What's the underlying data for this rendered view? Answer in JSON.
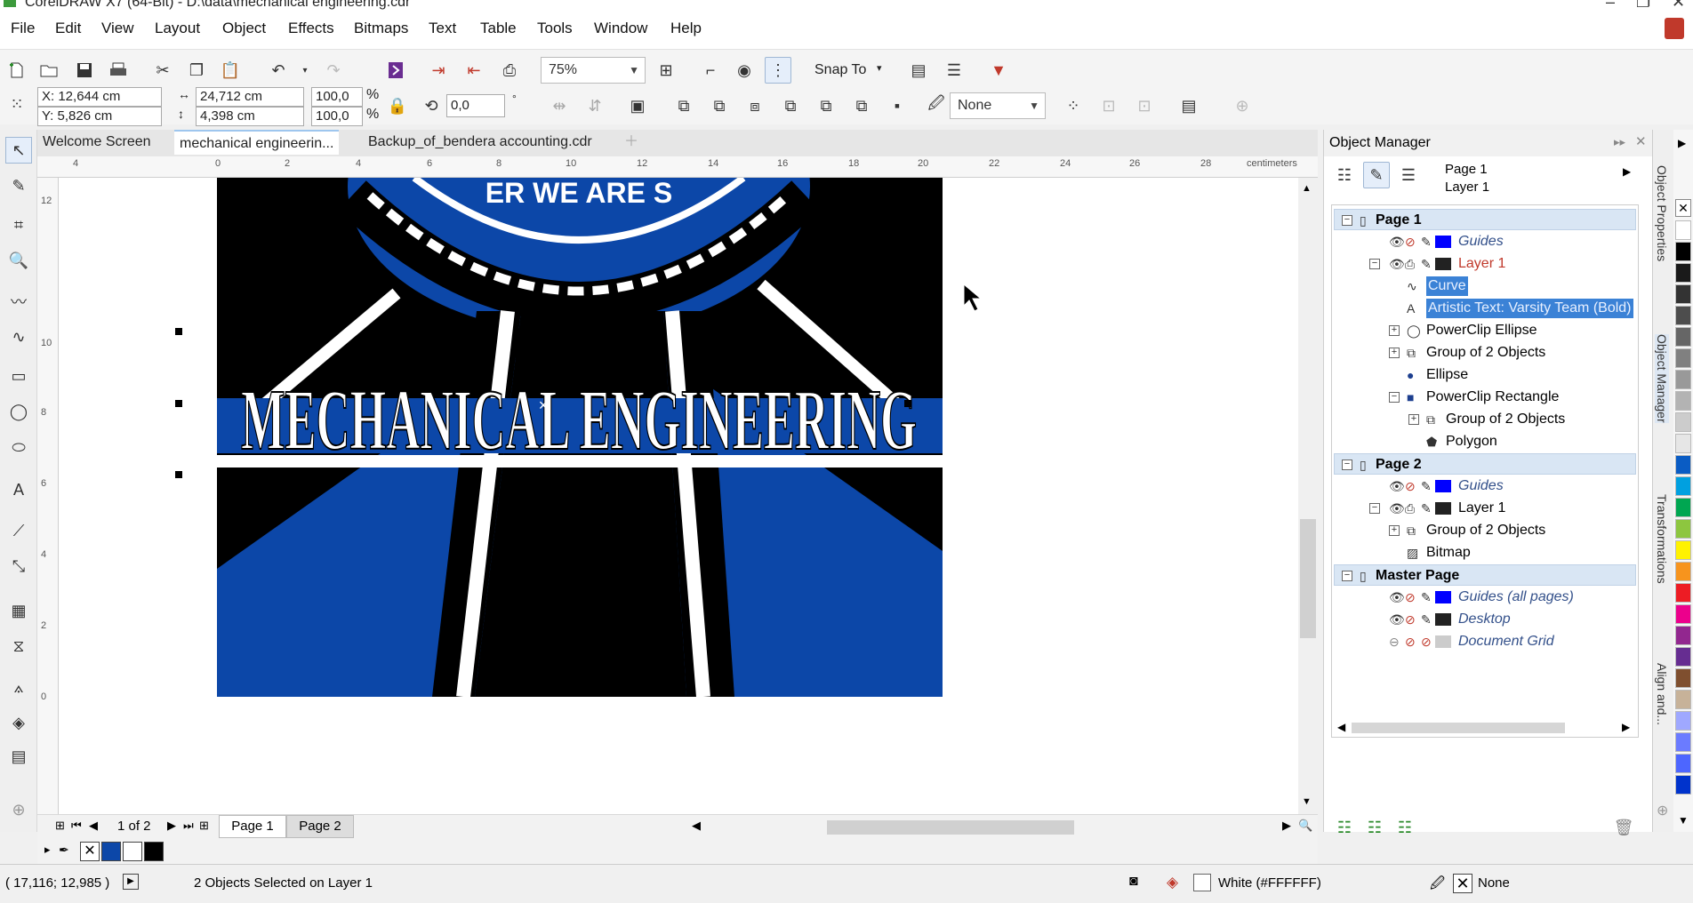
{
  "title": "CorelDRAW X7 (64-Bit) - D:\\data\\mechanical engineering.cdr",
  "menu": [
    "File",
    "Edit",
    "View",
    "Layout",
    "Object",
    "Effects",
    "Bitmaps",
    "Text",
    "Table",
    "Tools",
    "Window",
    "Help"
  ],
  "toolbar": {
    "zoom": "75%",
    "snap_to": "Snap To"
  },
  "properties": {
    "x": "X: 12,644 cm",
    "y": "Y: 5,826 cm",
    "width": "24,712 cm",
    "height": "4,398 cm",
    "scale_w": "100,0",
    "scale_h": "100,0",
    "pct": "%",
    "rotation": "0,0",
    "degree": "°",
    "outline": "None"
  },
  "tabs": [
    "Welcome Screen",
    "mechanical engineerin...",
    "Backup_of_bendera accounting.cdr"
  ],
  "ruler": {
    "unit": "centimeters",
    "h_ticks": [
      "4",
      "0",
      "2",
      "4",
      "6",
      "8",
      "10",
      "12",
      "14",
      "16",
      "18",
      "20",
      "22",
      "24",
      "26",
      "28"
    ],
    "v_ticks": [
      "12",
      "10",
      "8",
      "6",
      "4",
      "2",
      "0"
    ]
  },
  "artwork": {
    "headline": "MECHANICAL ENGINEERING",
    "arc_text": "ER WE ARE S",
    "colors": {
      "blue": "#0c47a8",
      "black": "#000000",
      "white": "#ffffff"
    }
  },
  "pages_nav": {
    "position": "1 of 2",
    "pages": [
      "Page 1",
      "Page 2"
    ]
  },
  "object_manager": {
    "title": "Object Manager",
    "current_page": "Page 1",
    "current_layer": "Layer 1",
    "tree": [
      {
        "label": "Page 1",
        "type": "page"
      },
      {
        "label": "Guides",
        "type": "guides"
      },
      {
        "label": "Layer 1",
        "type": "layer-active"
      },
      {
        "label": "Curve",
        "type": "selected"
      },
      {
        "label": "Artistic Text: Varsity Team (Bold)",
        "type": "selected"
      },
      {
        "label": "PowerClip Ellipse",
        "type": "item"
      },
      {
        "label": "Group of 2 Objects",
        "type": "item"
      },
      {
        "label": "Ellipse",
        "type": "item"
      },
      {
        "label": "PowerClip Rectangle",
        "type": "item"
      },
      {
        "label": "Group of 2 Objects",
        "type": "item"
      },
      {
        "label": "Polygon",
        "type": "item"
      },
      {
        "label": "Page 2",
        "type": "page"
      },
      {
        "label": "Guides",
        "type": "guides"
      },
      {
        "label": "Layer 1",
        "type": "layer"
      },
      {
        "label": "Group of 2 Objects",
        "type": "item"
      },
      {
        "label": "Bitmap",
        "type": "item"
      },
      {
        "label": "Master Page",
        "type": "page"
      },
      {
        "label": "Guides (all pages)",
        "type": "guides"
      },
      {
        "label": "Desktop",
        "type": "guides"
      },
      {
        "label": "Document Grid",
        "type": "guides"
      }
    ]
  },
  "dockers": [
    "Object Properties",
    "Object Manager",
    "Transformations",
    "Align and..."
  ],
  "status": {
    "coords": "( 17,116; 12,985 )",
    "selection": "2 Objects Selected on Layer 1",
    "fill": "White (#FFFFFF)",
    "outline": "None"
  },
  "palette_colors": [
    "#ffffff",
    "#000000",
    "#1a1a1a",
    "#333333",
    "#4d4d4d",
    "#666666",
    "#808080",
    "#999999",
    "#b3b3b3",
    "#cccccc",
    "#e6e6e6",
    "#0a5cc4",
    "#00a0e0",
    "#00a651",
    "#8dc63f",
    "#fff200",
    "#f7941d",
    "#ed1c24",
    "#ec008c",
    "#92278f",
    "#662d91",
    "#7f4f2f",
    "#c7b299",
    "#9fa8ff",
    "#6b7bff",
    "#4d66ff",
    "#0033cc"
  ],
  "doc_palette": [
    "#0c47a8",
    "#ffffff",
    "#000000"
  ]
}
